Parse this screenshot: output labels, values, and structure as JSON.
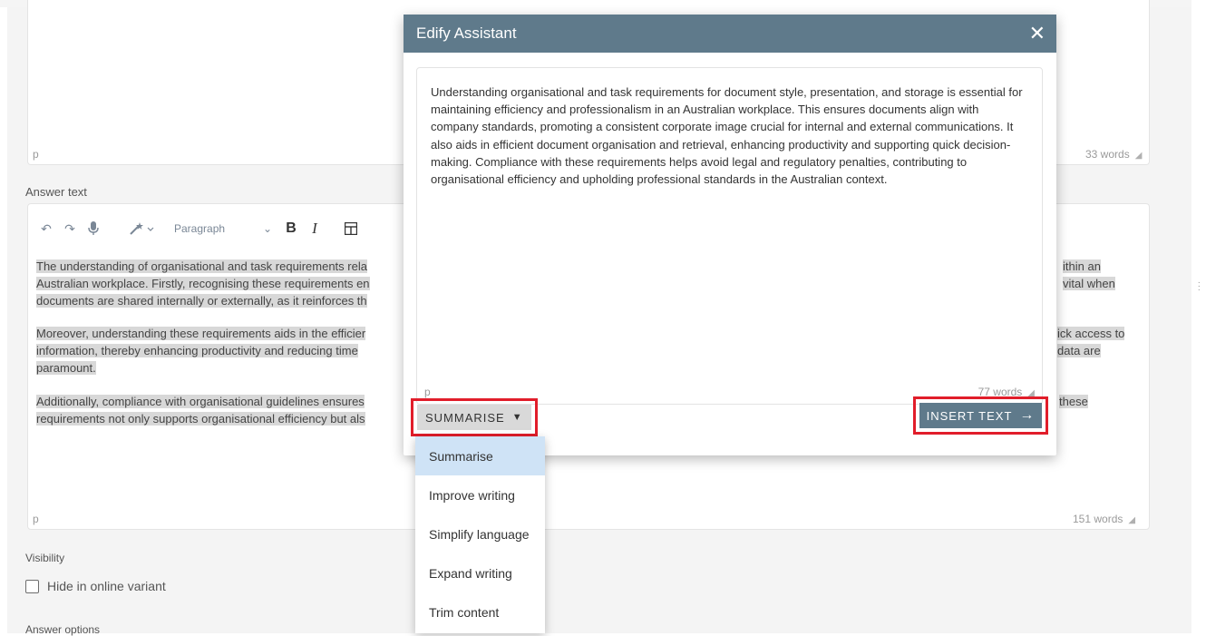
{
  "background": {
    "top_editor": {
      "tag": "p",
      "word_count": "33 words"
    },
    "answer_label": "Answer text",
    "toolbar": {
      "paragraph_select": "Paragraph",
      "bold": "B",
      "italic": "I"
    },
    "answer_paragraphs": [
      {
        "left_line1": "The understanding of organisational and task requirements rela",
        "left_line2": "Australian workplace. Firstly, recognising these requirements en",
        "left_line3": "documents are shared internally or externally, as it reinforces th",
        "right_line1": "ithin an",
        "right_line2": "vital when"
      },
      {
        "left_line1": "Moreover, understanding these requirements aids in the efficier",
        "left_line2": "information, thereby enhancing productivity and reducing time",
        "left_line3": "paramount.",
        "right_line1": "ick access to",
        "right_line2": "data are"
      },
      {
        "left_line1": "Additionally, compliance with organisational guidelines ensures",
        "left_line2": "requirements not only supports organisational efficiency but als",
        "right_line1": "these"
      }
    ],
    "answer_editor": {
      "tag": "p",
      "word_count": "151 words"
    },
    "visibility_label": "Visibility",
    "hide_checkbox_label": "Hide in online variant",
    "answer_options_label": "Answer options"
  },
  "modal": {
    "title": "Edify Assistant",
    "close": "✕",
    "body_text": "Understanding organisational and task requirements for document style, presentation, and storage is essential for maintaining efficiency and professionalism in an Australian workplace. This ensures documents align with company standards, promoting a consistent corporate image crucial for internal and external communications. It also aids in efficient document organisation and retrieval, enhancing productivity and supporting quick decision-making. Compliance with these requirements helps avoid legal and regulatory penalties, contributing to organisational efficiency and upholding professional standards in the Australian context.",
    "tag": "p",
    "word_count": "77 words",
    "summarise_button": "SUMMARISE",
    "insert_button": "INSERT TEXT"
  },
  "dropdown": {
    "items": [
      "Summarise",
      "Improve writing",
      "Simplify language",
      "Expand writing",
      "Trim content"
    ],
    "selected_index": 0
  },
  "colors": {
    "header": "#5f7a8b",
    "highlight_border": "#e11d2a",
    "selected_item": "#cfe3f6"
  }
}
